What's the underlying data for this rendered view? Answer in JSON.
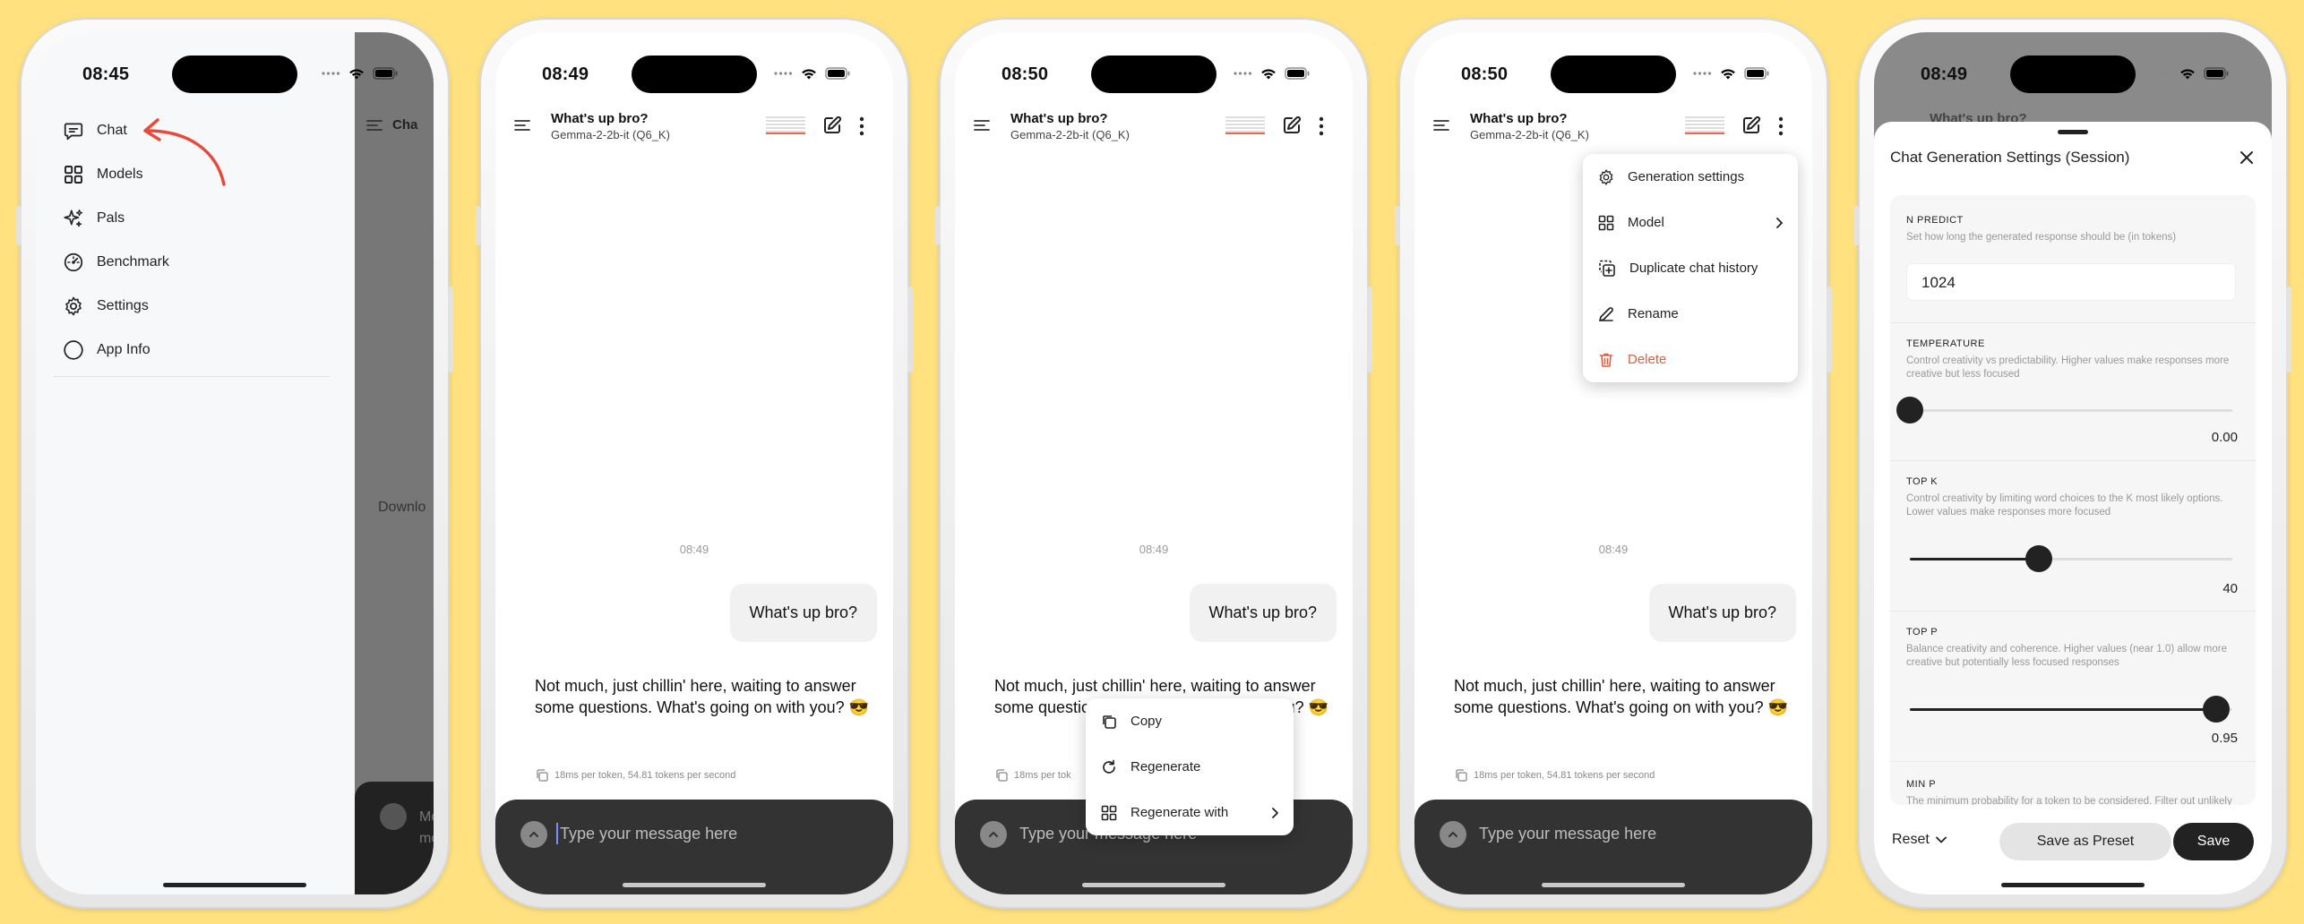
{
  "status": {
    "time1": "08:45",
    "time2": "08:49",
    "time3": "08:50",
    "time4": "08:50",
    "time5": "08:49"
  },
  "drawer": {
    "items": [
      {
        "label": "Chat",
        "icon": "chat-bubble-icon"
      },
      {
        "label": "Models",
        "icon": "grid-icon"
      },
      {
        "label": "Pals",
        "icon": "sparkles-icon"
      },
      {
        "label": "Benchmark",
        "icon": "gauge-icon"
      },
      {
        "label": "Settings",
        "icon": "gear-icon"
      },
      {
        "label": "App Info",
        "icon": "info-circle-icon"
      }
    ],
    "peek_title": "Cha",
    "peek_download": "Downlo",
    "peek_input": "Mo\nmo",
    "arrow_color": "#E8493C"
  },
  "chat": {
    "title": "What's up bro?",
    "model": "Gemma-2-2b-it (Q6_K)",
    "time": "08:49",
    "user_msg": "What's up bro?",
    "bot_msg": "Not much, just chillin' here, waiting to answer some questions. What's going on with you? 😎",
    "bot_meta": "18ms per token, 54.81 tokens per second",
    "bot_meta_short": "18ms per tok",
    "input_placeholder": "Type your message here"
  },
  "context_menu": {
    "copy": "Copy",
    "regenerate": "Regenerate",
    "regenerate_with": "Regenerate with"
  },
  "more_menu": {
    "generation_settings": "Generation settings",
    "model": "Model",
    "duplicate": "Duplicate chat history",
    "rename": "Rename",
    "delete": "Delete",
    "delete_color": "#E35D3C"
  },
  "settings": {
    "title": "Chat Generation Settings (Session)",
    "n_predict_label": "N PREDICT",
    "n_predict_desc": "Set how long the generated response should be (in tokens)",
    "n_predict_value": "1024",
    "temperature_label": "TEMPERATURE",
    "temperature_desc": "Control creativity vs predictability. Higher values make responses more creative but less focused",
    "temperature_value": "0.00",
    "temperature_fraction": 0.0,
    "top_k_label": "TOP K",
    "top_k_desc": "Control creativity by limiting word choices to the K most likely options. Lower values make responses more focused",
    "top_k_value": "40",
    "top_k_fraction": 0.4,
    "top_p_label": "TOP P",
    "top_p_desc": "Balance creativity and coherence. Higher values (near 1.0) allow more creative but potentially less focused responses",
    "top_p_value": "0.95",
    "top_p_fraction": 0.95,
    "min_p_label": "MIN P",
    "min_p_desc": "The minimum probability for a token to be considered. Filter out unlikely words to reduce nonsensical or out-of-",
    "reset": "Reset",
    "save_preset": "Save as Preset",
    "save": "Save"
  }
}
